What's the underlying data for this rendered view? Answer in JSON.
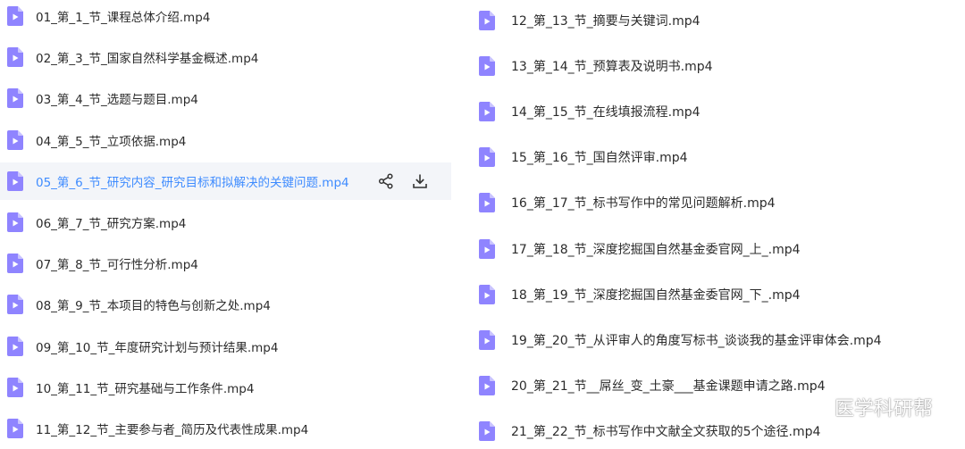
{
  "colors": {
    "icon_fill": "#8f84ff",
    "icon_fold": "#ffffff",
    "text": "#2b2b2b",
    "active_text": "#3f8cff",
    "active_bg": "#f3f5f9"
  },
  "icons": {
    "file": "video-file-icon",
    "share": "share-icon",
    "download": "download-icon",
    "watermark_logo": "wechat-logo-icon"
  },
  "left_files": [
    {
      "name": "01_第_1_节_课程总体介绍.mp4"
    },
    {
      "name": "02_第_3_节_国家自然科学基金概述.mp4"
    },
    {
      "name": "03_第_4_节_选题与题目.mp4"
    },
    {
      "name": "04_第_5_节_立项依据.mp4"
    },
    {
      "name": "05_第_6_节_研究内容_研究目标和拟解决的关键问题.mp4",
      "active": true
    },
    {
      "name": "06_第_7_节_研究方案.mp4"
    },
    {
      "name": "07_第_8_节_可行性分析.mp4"
    },
    {
      "name": "08_第_9_节_本项目的特色与创新之处.mp4"
    },
    {
      "name": "09_第_10_节_年度研究计划与预计结果.mp4"
    },
    {
      "name": "10_第_11_节_研究基础与工作条件.mp4"
    },
    {
      "name": "11_第_12_节_主要参与者_简历及代表性成果.mp4"
    }
  ],
  "right_files": [
    {
      "name": "12_第_13_节_摘要与关键词.mp4"
    },
    {
      "name": "13_第_14_节_预算表及说明书.mp4"
    },
    {
      "name": "14_第_15_节_在线填报流程.mp4"
    },
    {
      "name": "15_第_16_节_国自然评审.mp4"
    },
    {
      "name": "16_第_17_节_标书写作中的常见问题解析.mp4"
    },
    {
      "name": "17_第_18_节_深度挖掘国自然基金委官网_上_.mp4"
    },
    {
      "name": "18_第_19_节_深度挖掘国自然基金委官网_下_.mp4"
    },
    {
      "name": "19_第_20_节_从评审人的角度写标书_谈谈我的基金评审体会.mp4"
    },
    {
      "name": "20_第_21_节__屌丝_变_土豪___基金课题申请之路.mp4"
    },
    {
      "name": "21_第_22_节_标书写作中文献全文获取的5个途径.mp4"
    }
  ],
  "watermark": {
    "text": "医学科研帮"
  }
}
